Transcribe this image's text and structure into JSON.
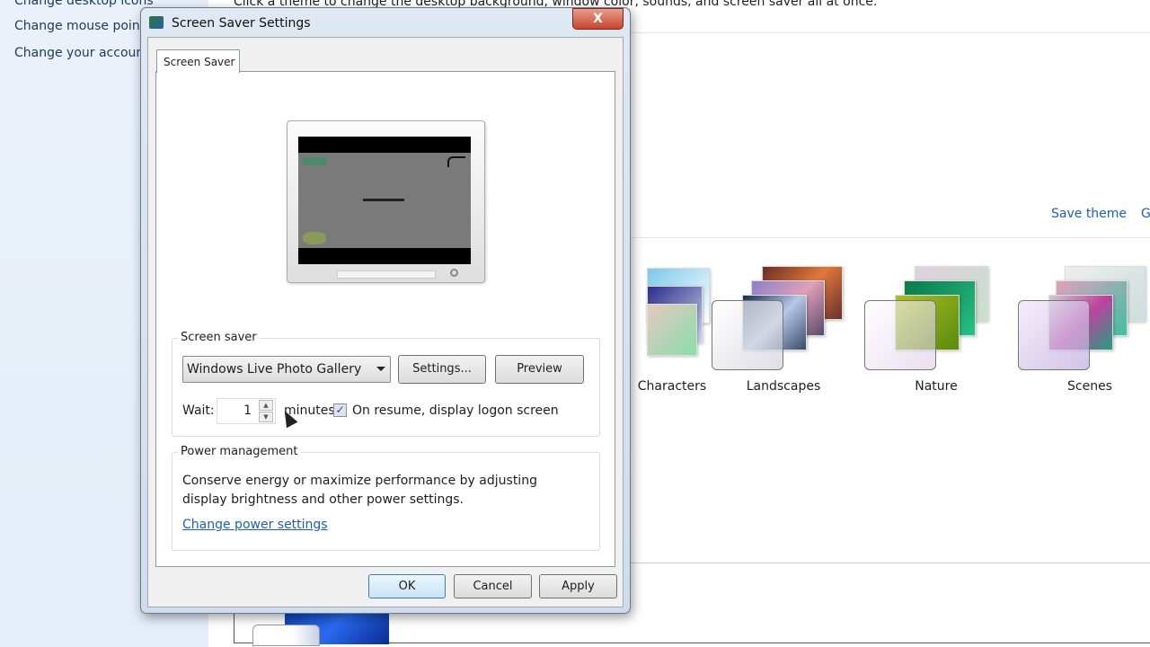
{
  "sidebar": {
    "items": [
      {
        "label": "Change desktop icons"
      },
      {
        "label": "Change mouse pointers"
      },
      {
        "label": "Change your account picture"
      }
    ]
  },
  "main": {
    "instruction": "Click a theme to change the desktop background, window color, sounds, and screen saver all at once.",
    "save_theme": "Save theme",
    "get_more_partial": "G",
    "themes": [
      {
        "label": "Characters"
      },
      {
        "label": "Landscapes"
      },
      {
        "label": "Nature"
      },
      {
        "label": "Scenes"
      }
    ]
  },
  "dialog": {
    "title": "Screen Saver Settings",
    "close_label": "X",
    "tab": "Screen Saver",
    "screen_saver": {
      "group_label": "Screen saver",
      "selected": "Windows Live Photo Gallery",
      "settings_button": "Settings...",
      "preview_button": "Preview",
      "wait_label": "Wait:",
      "wait_value": "1",
      "minutes_label": "minutes",
      "logon_checked": true,
      "logon_label": "On resume, display logon screen"
    },
    "power": {
      "group_label": "Power management",
      "description_line1": "Conserve energy or maximize performance by adjusting",
      "description_line2": "display brightness and other power settings.",
      "link": "Change power settings"
    },
    "buttons": {
      "ok": "OK",
      "cancel": "Cancel",
      "apply": "Apply"
    }
  },
  "colors": {
    "link": "#1f5fb0",
    "sidebar_bg": "#eaf1fa",
    "close_button": "#c8442c"
  }
}
